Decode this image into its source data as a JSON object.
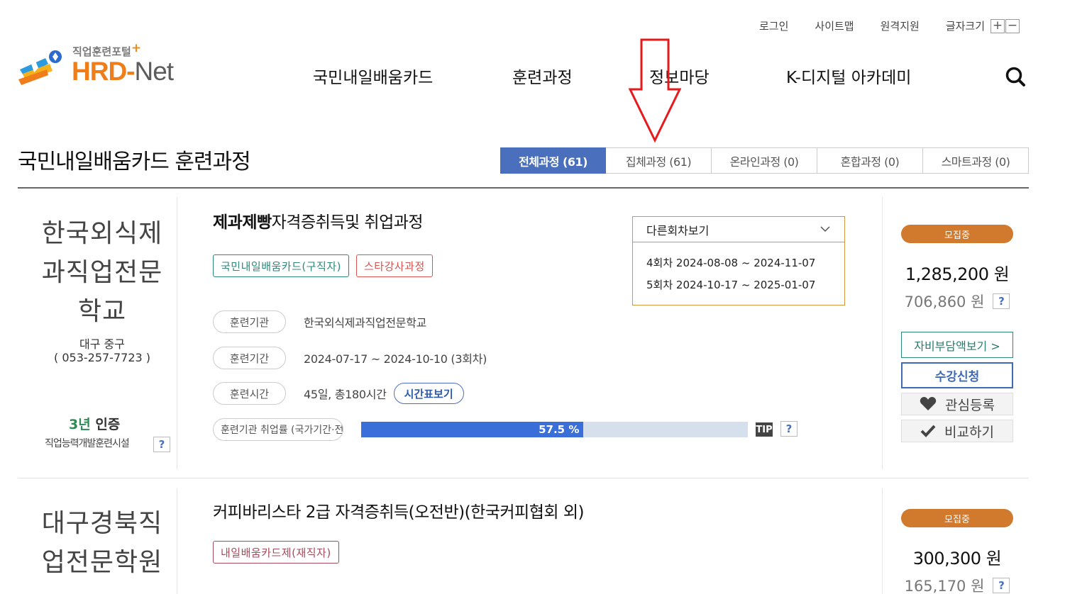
{
  "utility": {
    "login": "로그인",
    "sitemap": "사이트맵",
    "remote": "원격지원",
    "font_size": "글자크기",
    "plus": "+",
    "minus": "−"
  },
  "logo": {
    "sub": "직업훈련포털",
    "plus": "+",
    "hrd": "HRD",
    "dash": "-",
    "net": "Net"
  },
  "gnb": {
    "items": [
      "국민내일배움카드",
      "훈련과정",
      "정보마당",
      "K-디지털 아카데미"
    ]
  },
  "page": {
    "title": "국민내일배움카드 훈련과정",
    "tabs": [
      "전체과정 (61)",
      "집체과정 (61)",
      "온라인과정 (0)",
      "혼합과정 (0)",
      "스마트과정 (0)"
    ]
  },
  "courses": [
    {
      "institution_lines": [
        "한국외식제",
        "과직업전문",
        "학교"
      ],
      "location": "대구 중구",
      "phone": "( 053-257-7723 )",
      "cert_years": "3년",
      "cert_label": "인증",
      "cert_sub": "직업능력개발훈련시설",
      "help": "?",
      "title_bold": "제과제빵",
      "title_rest": "자격증취득및 취업과정",
      "badges": [
        "국민내일배움카드(구직자)",
        "스타강사과정"
      ],
      "rows": {
        "org_label": "훈련기관",
        "org_value": "한국외식제과직업전문학교",
        "period_label": "훈련기간",
        "period_value": "2024-07-17 ~ 2024-10-10 (3회차)",
        "time_label": "훈련시간",
        "time_value": "45일, 총180시간",
        "timetable_btn": "시간표보기",
        "employment_label": "훈련기관 취업률 (국가기간·전략산업직종)",
        "employment_rate": "57.5 %",
        "employment_fraction": 0.575,
        "tip": "TIP"
      },
      "other_rounds": {
        "head": "다른회차보기",
        "items": [
          "4회차 2024-08-08 ~ 2024-11-07",
          "5회차 2024-10-17 ~ 2025-01-07"
        ]
      },
      "status": "모집중",
      "price": "1,285,200 원",
      "self_pay": "706,860 원",
      "self_pay_btn": "자비부담액보기 >",
      "apply_btn": "수강신청",
      "interest_btn": "관심등록",
      "compare_btn": "비교하기"
    },
    {
      "institution_lines": [
        "대구경북직",
        "업전문학원"
      ],
      "title": "커피바리스타 2급 자격증취득(오전반)(한국커피협회 외)",
      "badges": [
        "내일배움카드제(재직자)"
      ],
      "status": "모집중",
      "price": "300,300 원",
      "self_pay": "165,170 원",
      "help": "?"
    }
  ],
  "colors": {
    "accent_blue": "#4a70bd",
    "orange": "#d17a2e",
    "teal": "#2d8a7a",
    "red_badge": "#d9534f",
    "arrow_red": "#e8191b"
  }
}
